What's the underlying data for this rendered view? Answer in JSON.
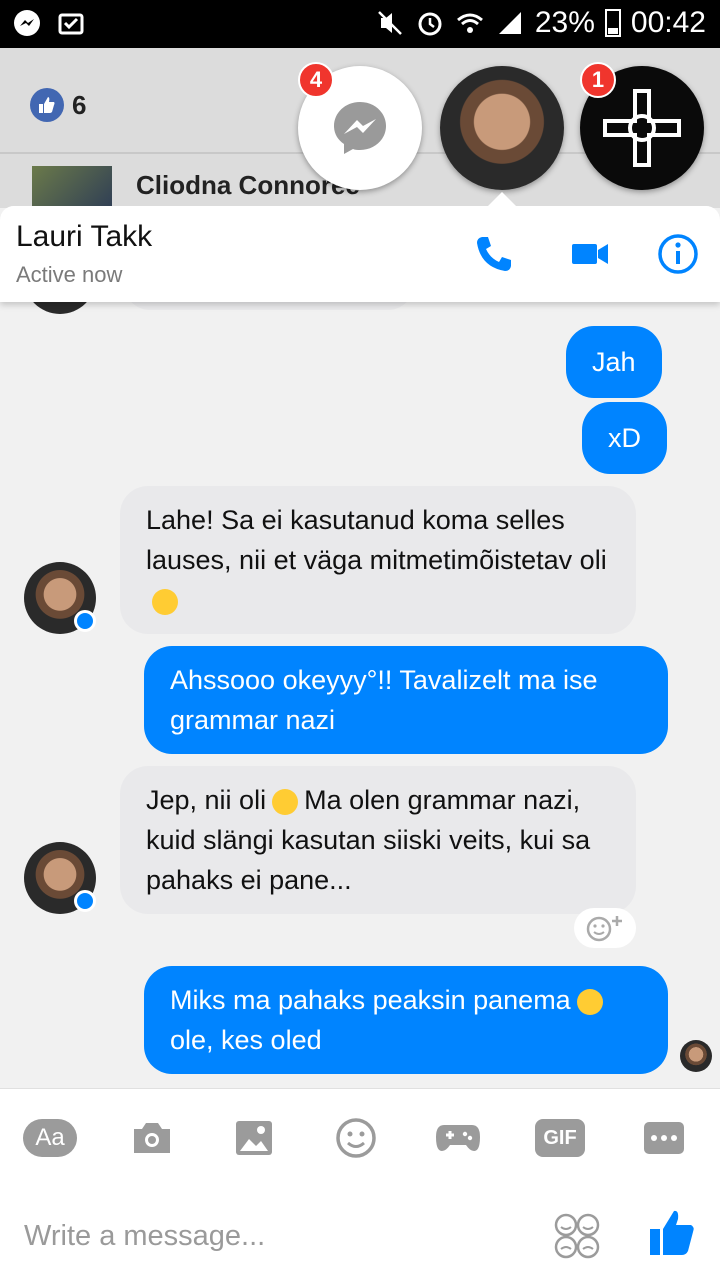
{
  "status_bar": {
    "battery": "23%",
    "time": "00:42"
  },
  "background": {
    "likes_count": "6",
    "friend_name": "Cliodna Connoree"
  },
  "chat_heads": {
    "messenger_badge": "4",
    "group_badge": "1"
  },
  "header": {
    "contact_name": "Lauri Takk",
    "status": "Active now"
  },
  "messages": [
    {
      "from": "me",
      "text": "Jah"
    },
    {
      "from": "me",
      "text": "xD"
    },
    {
      "from": "them",
      "text": "Lahe! Sa ei kasutanud koma selles lauses, nii et väga mitmetimõistetav oli"
    },
    {
      "from": "me",
      "text": "Ahssooo okeyyy°!! Tavalizelt ma ise grammar nazi"
    },
    {
      "from": "them",
      "text": "Jep, nii oli",
      "text2": "Ma olen grammar nazi, kuid slängi kasutan siiski veits, kui sa pahaks ei pane..."
    },
    {
      "from": "me",
      "text": "Miks ma pahaks peaksin panema",
      "text2": "ole, kes oled"
    }
  ],
  "composer": {
    "placeholder": "Write a message...",
    "text_button": "Aa",
    "gif_button": "GIF"
  },
  "colors": {
    "accent": "#0084ff",
    "incoming_bubble": "#e9e9eb",
    "badge": "#f0352d"
  }
}
